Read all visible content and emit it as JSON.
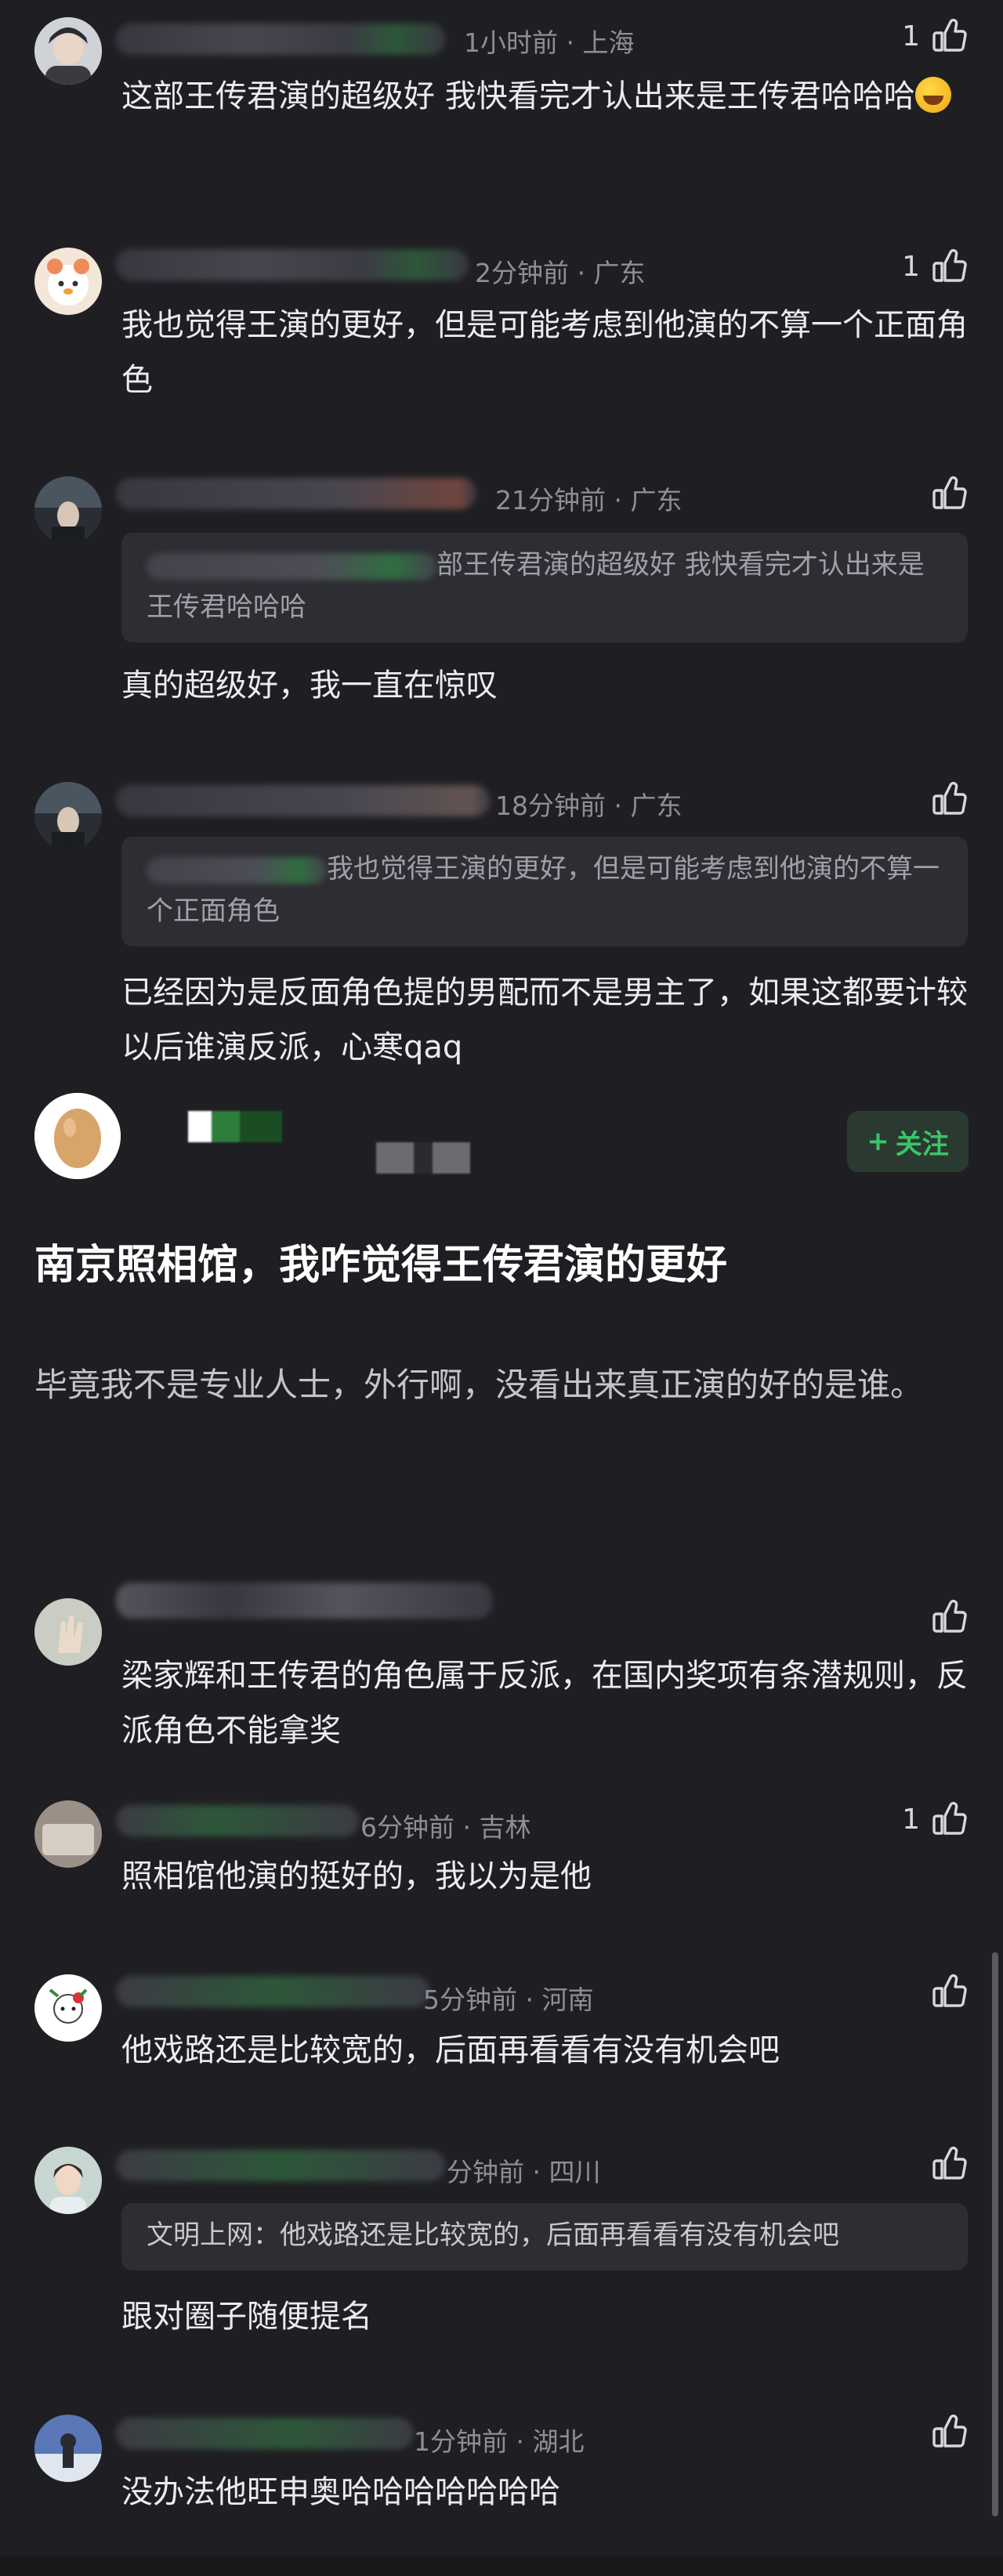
{
  "comments": [
    {
      "meta": "1小时前 · 上海",
      "likes": "1",
      "text": "这部王传君演的超级好 我快看完才认出来是王传君哈哈哈"
    },
    {
      "meta": "2分钟前 · 广东",
      "likes": "1",
      "text": "我也觉得王演的更好，但是可能考虑到他演的不算一个正面角色"
    },
    {
      "meta": "21分钟前 · 广东",
      "likes": "",
      "quote": "部王传君演的超级好 我快看完才认出来是王传君哈哈哈",
      "text": "真的超级好，我一直在惊叹"
    },
    {
      "meta": "18分钟前 · 广东",
      "likes": "",
      "quote": "我也觉得王演的更好，但是可能考虑到他演的不算一个正面角色",
      "text": "已经因为是反面角色提的男配而不是男主了，如果这都要计较以后谁演反派，心寒qaq"
    }
  ],
  "post": {
    "follow_label": "关注",
    "follow_plus": "+",
    "title": "南京照相馆，我咋觉得王传君演的更好",
    "body": "毕竟我不是专业人士，外行啊，没看出来真正演的好的是谁。"
  },
  "replies": [
    {
      "meta": "",
      "likes": "",
      "text": "梁家辉和王传君的角色属于反派，在国内奖项有条潜规则，反派角色不能拿奖"
    },
    {
      "meta": "6分钟前 · 吉林",
      "likes": "1",
      "text": "照相馆他演的挺好的，我以为是他"
    },
    {
      "meta": "5分钟前 · 河南",
      "likes": "",
      "text": "他戏路还是比较宽的，后面再看看有没有机会吧"
    },
    {
      "meta": "分钟前 · 四川",
      "likes": "",
      "quote_author": "文明上网：",
      "quote": "他戏路还是比较宽的，后面再看看有没有机会吧",
      "text": "跟对圈子随便提名"
    },
    {
      "meta": "1分钟前 · 湖北",
      "likes": "",
      "text": "没办法他旺申奥哈哈哈哈哈哈哈"
    }
  ],
  "icons": {
    "like": "thumbs-up-icon",
    "emoji": "rofl-emoji-icon"
  },
  "colors": {
    "background": "#1f1f23",
    "follow_green": "#3cc46a",
    "meta_gray": "#8e8e96"
  }
}
